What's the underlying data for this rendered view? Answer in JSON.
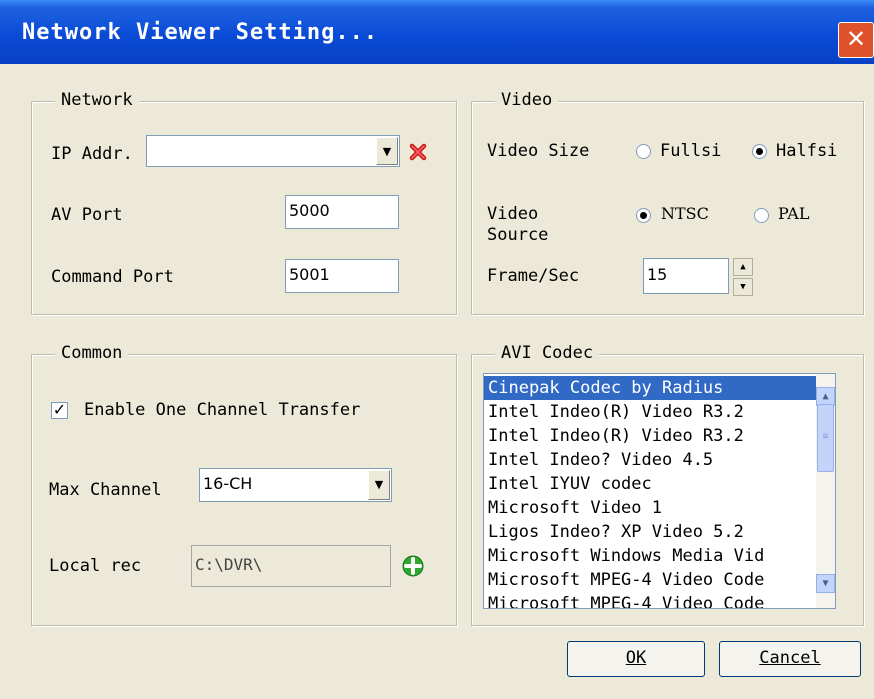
{
  "window": {
    "title": "Network Viewer Setting...",
    "close_glyph": "✕"
  },
  "network": {
    "legend": "Network",
    "ip_label": "IP Addr.",
    "ip_value": "",
    "ip_clear_icon": "red-x-icon",
    "av_port_label": "AV Port",
    "av_port_value": "5000",
    "cmd_port_label": "Command Port",
    "cmd_port_value": "5001"
  },
  "video": {
    "legend": "Video",
    "size_label": "Video Size",
    "size_options": [
      "Fullsi",
      "Halfsi"
    ],
    "size_selected": "Halfsi",
    "source_label": "Video Source",
    "source_options": [
      "NTSC",
      "PAL"
    ],
    "source_selected": "NTSC",
    "fps_label": "Frame/Sec",
    "fps_value": "15"
  },
  "common": {
    "legend": "Common",
    "enable_label": "Enable One Channel Transfer",
    "enable_checked": true,
    "max_channel_label": "Max Channel",
    "max_channel_value": "16-CH",
    "local_rec_label": "Local rec",
    "local_rec_value": "C:\\DVR\\",
    "browse_icon": "green-plus-icon"
  },
  "codec": {
    "legend": "AVI Codec",
    "items": [
      "Cinepak Codec by Radius",
      "Intel Indeo(R) Video R3.2",
      "Intel Indeo(R) Video R3.2",
      "Intel Indeo? Video 4.5",
      "Intel IYUV codec",
      "Microsoft Video 1",
      "Ligos Indeo? XP Video 5.2",
      "Microsoft Windows Media Vid",
      "Microsoft MPEG-4 Video Code",
      "Microsoft MPEG-4 Video Code"
    ],
    "selected_index": 0
  },
  "buttons": {
    "ok_label": "OK",
    "cancel_label": "Cancel"
  },
  "colors": {
    "title_bar": "#0a4bd6",
    "dialog_bg": "#ece9d8",
    "selection": "#316ac5",
    "close": "#e0522c"
  }
}
